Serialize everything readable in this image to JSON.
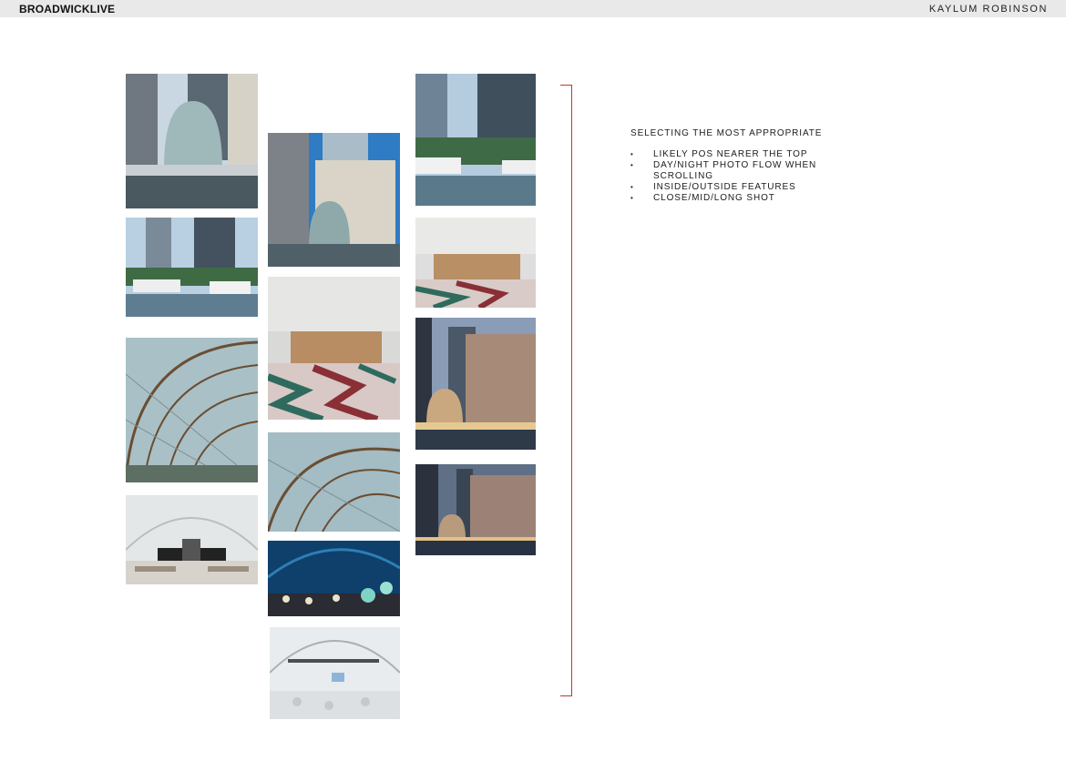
{
  "header": {
    "brand": "BROADWICKLIVE",
    "author": "KAYLUM ROBINSON"
  },
  "notes": {
    "heading": "SELECTING THE MOST APPROPRIATE",
    "items": [
      "LIKELY POS NEARER THE TOP",
      "DAY/NIGHT PHOTO FLOW WHEN SCROLLING",
      "INSIDE/OUTSIDE FEATURES",
      "CLOSE/MID/LONG SHOT"
    ]
  },
  "colors": {
    "accent": "#c0392b",
    "topbar": "#e9e9e9"
  }
}
